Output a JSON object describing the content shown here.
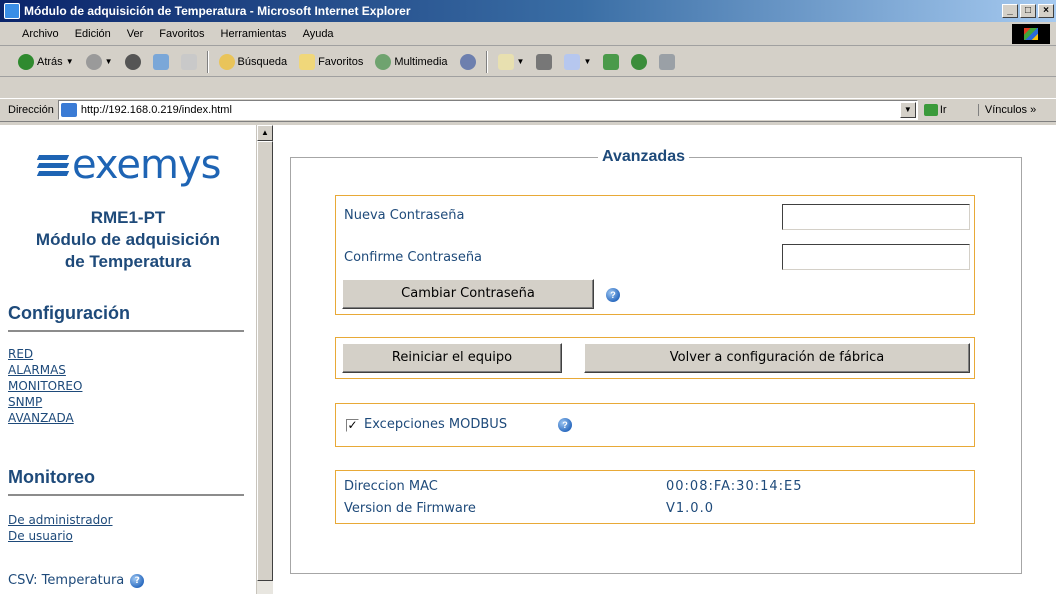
{
  "window": {
    "title": "Módulo de adquisición de Temperatura - Microsoft Internet Explorer",
    "minimize": "_",
    "maximize": "□",
    "close": "×"
  },
  "menu": {
    "items": [
      "Archivo",
      "Edición",
      "Ver",
      "Favoritos",
      "Herramientas",
      "Ayuda"
    ]
  },
  "toolbar": {
    "back_label": "Atrás",
    "search_label": "Búsqueda",
    "favorites_label": "Favoritos",
    "multimedia_label": "Multimedia"
  },
  "address": {
    "label": "Dirección",
    "url": "http://192.168.0.219/index.html",
    "go_label": "Ir",
    "links_label": "Vínculos »"
  },
  "sidebar": {
    "logo_text": "exemys",
    "product_line1": "RME1-PT",
    "product_line2": "Módulo de adquisición",
    "product_line3": "de Temperatura",
    "config_title": "Configuración",
    "config_links": [
      "RED",
      "ALARMAS",
      "MONITOREO",
      "SNMP",
      "AVANZADA"
    ],
    "monitor_title": "Monitoreo",
    "monitor_links": [
      "De administrador",
      "De usuario"
    ],
    "csv_label": "CSV: Temperatura"
  },
  "main": {
    "legend": "Avanzadas",
    "password": {
      "new_label": "Nueva Contraseña",
      "confirm_label": "Confirme Contraseña",
      "new_value": "",
      "confirm_value": "",
      "change_button": "Cambiar Contraseña"
    },
    "actions": {
      "restart_button": "Reiniciar el equipo",
      "factory_button": "Volver a configuración de fábrica"
    },
    "modbus": {
      "checked": true,
      "label": "Excepciones MODBUS"
    },
    "info": {
      "mac_label": "Direccion MAC",
      "mac_value": "00:08:FA:30:14:E5",
      "firmware_label": "Version de Firmware",
      "firmware_value": "V1.0.0"
    }
  },
  "colors": {
    "title_bar": "#0a246a",
    "group_border": "#e8a937",
    "text_blue": "#1e4a7a",
    "logo_blue": "#1e64b4"
  }
}
